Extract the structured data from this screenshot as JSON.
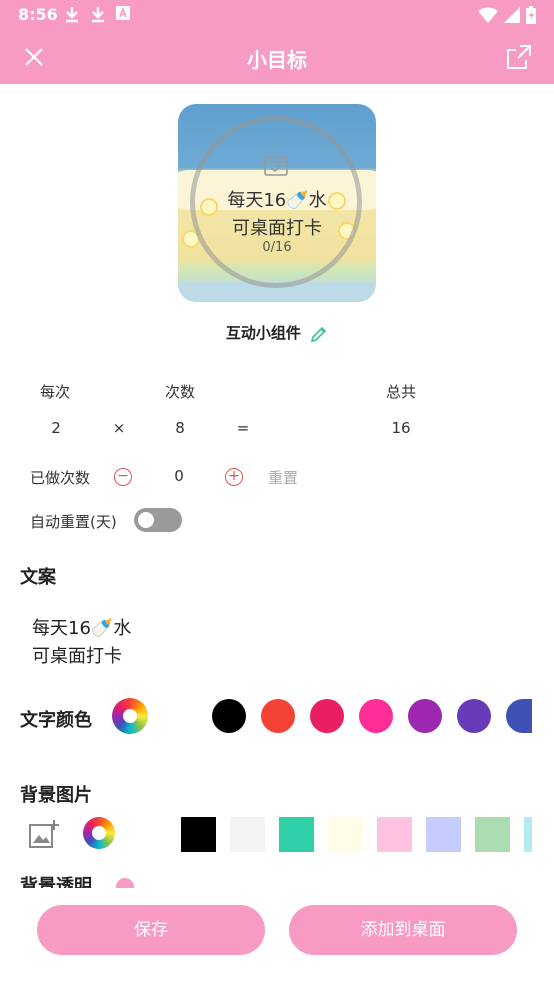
{
  "status": {
    "time": "8:56"
  },
  "appbar": {
    "title": "小目标"
  },
  "widget": {
    "line1": "每天16🍼水",
    "line2": "可桌面打卡",
    "progress": "0/16",
    "progress_fraction": 0
  },
  "widget_label": "互动小组件",
  "counter": {
    "each_label": "每次",
    "times_label": "次数",
    "total_label": "总共",
    "each_value": "2",
    "times_symbol": "×",
    "times_value": "8",
    "equals_symbol": "=",
    "total_value": "16"
  },
  "done": {
    "label": "已做次数",
    "minus": "−",
    "value": "0",
    "plus": "+",
    "reset": "重置"
  },
  "auto_reset": {
    "label": "自动重置(天)",
    "enabled": false
  },
  "copy_section": {
    "title": "文案",
    "line1": "每天16🍼水",
    "line2": "可桌面打卡"
  },
  "text_color": {
    "title": "文字颜色",
    "swatches": [
      "#000000",
      "#f44336",
      "#e91e63",
      "#ff2d95",
      "#9c27b0",
      "#673ab7",
      "#3f51b5"
    ]
  },
  "background": {
    "title": "背景图片",
    "swatches": [
      "#000000",
      "#f1f3f5",
      "#2fd0a8",
      "#fffce8",
      "#ffc2e0",
      "#c6ccfb",
      "#a9dcb0",
      "#b2ebf2"
    ]
  },
  "partial_section": {
    "title": "背景透明"
  },
  "actions": {
    "save": "保存",
    "add_to_desktop": "添加到桌面"
  }
}
